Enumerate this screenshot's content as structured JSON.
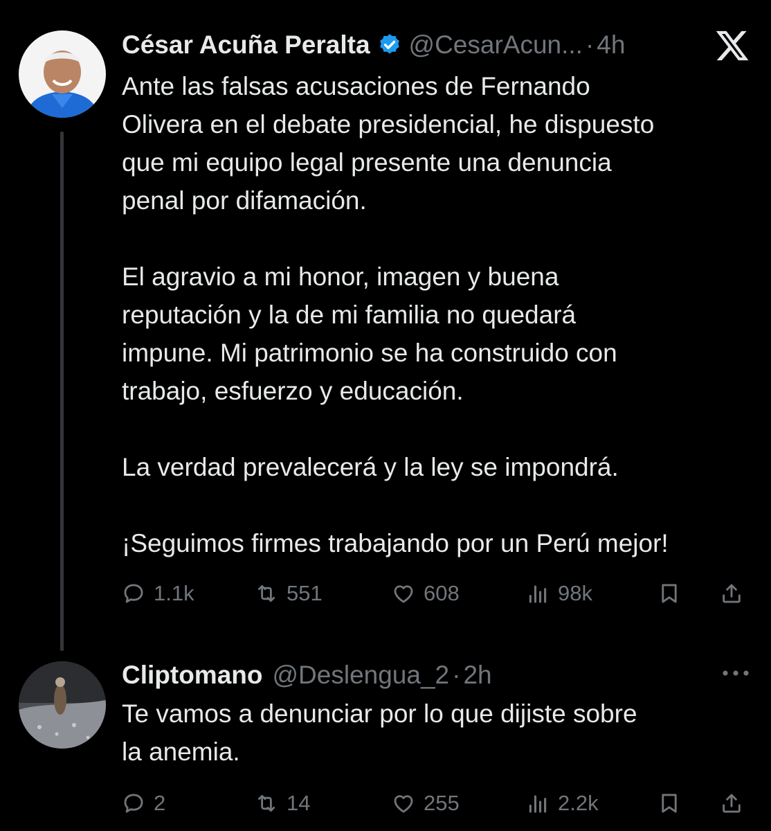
{
  "app": {
    "logo_icon": "x-logo-icon",
    "accent_color": "#1d9bf0",
    "text_color": "#e7e9ea",
    "secondary_color": "#71767b"
  },
  "tweets": [
    {
      "author_name": "César Acuña Peralta",
      "verified": true,
      "handle": "@CesarAcun...",
      "separator": "·",
      "time": "4h",
      "text": "Ante las falsas acusaciones de Fernando\nOlivera en el debate presidencial, he dispuesto\nque mi equipo legal presente una denuncia\npenal por difamación.\n\nEl agravio a mi honor, imagen y buena\nreputación y la de mi familia no quedará\nimpune. Mi patrimonio se ha construido con\ntrabajo, esfuerzo y educación.\n\nLa verdad prevalecerá y la ley se impondrá.\n\n¡Seguimos firmes trabajando por un Perú mejor!",
      "stats": {
        "replies": "1.1k",
        "reposts": "551",
        "likes": "608",
        "views": "98k"
      }
    },
    {
      "author_name": "Cliptomano",
      "verified": false,
      "handle": "@Deslengua_2",
      "separator": "·",
      "time": "2h",
      "text": "Te vamos a denunciar por lo que dijiste sobre\nla anemia.",
      "stats": {
        "replies": "2",
        "reposts": "14",
        "likes": "255",
        "views": "2.2k"
      }
    }
  ]
}
